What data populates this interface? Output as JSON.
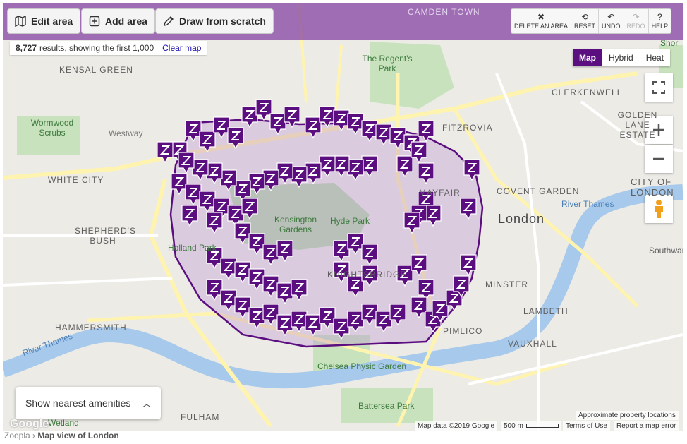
{
  "toolbar": {
    "edit_area": "Edit area",
    "add_area": "Add area",
    "draw_from_scratch": "Draw from scratch",
    "delete_area": "DELETE AN AREA",
    "reset": "RESET",
    "undo": "UNDO",
    "redo": "REDO",
    "help": "HELP"
  },
  "results": {
    "count": "8,727",
    "text": "results, showing the first 1,000",
    "clear": "Clear map"
  },
  "map_type": {
    "map": "Map",
    "hybrid": "Hybrid",
    "heat": "Heat",
    "selected": "Map"
  },
  "amenities": {
    "label": "Show nearest amenities"
  },
  "labels": {
    "camden": "CAMDEN TOWN",
    "kensal": "KENSAL GREEN",
    "wormwood": "Wormwood Scrubs",
    "white_city": "WHITE CITY",
    "westway": "Westway",
    "shepherds": "SHEPHERD'S BUSH",
    "holland": "Holland Park",
    "hammersmith": "HAMMERSMITH",
    "river_w": "River Thames",
    "fulham": "FULHAM",
    "wetland": "Wetland",
    "regents": "The Regent's Park",
    "fitzrovia": "FITZROVIA",
    "clerkenwell": "CLERKENWELL",
    "golden_lane": "GOLDEN LANE ESTATE",
    "covent": "COVENT GARDEN",
    "city": "CITY OF LONDON",
    "london": "London",
    "river_e": "River Thames",
    "southwark": "Southwark",
    "lambeth": "LAMBETH",
    "vauxhall": "VAUXHALL",
    "chelsea_physic": "Chelsea Physic Garden",
    "battersea": "Battersea Park",
    "kensington_gardens": "Kensington Gardens",
    "hyde_park": "Hyde Park",
    "mayfair": "MAYFAIR",
    "knightsbridge": "KNIGHTSBRIDGE",
    "pimlico": "PIMLICO",
    "minster": "MINSTER",
    "shor": "Shor"
  },
  "attribution": {
    "approx": "Approximate property locations",
    "map_data": "Map data ©2019 Google",
    "scale": "500 m",
    "terms": "Terms of Use",
    "report": "Report a map error"
  },
  "google_logo": "Google",
  "breadcrumb": {
    "home": "Zoopla",
    "current": "Map view of London"
  },
  "colors": {
    "accent": "#5b0e7f",
    "marker": "#5b0e7f",
    "area_fill": "#b98fd0"
  }
}
